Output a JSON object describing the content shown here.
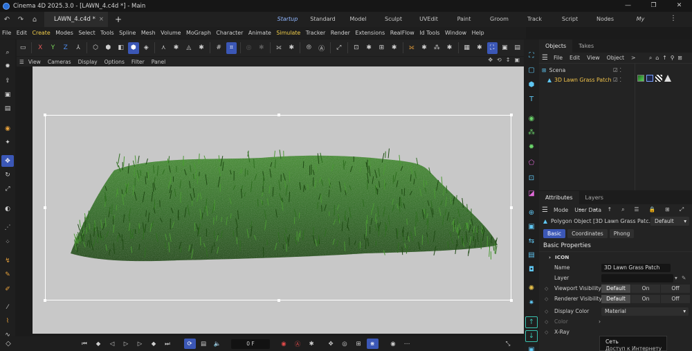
{
  "window": {
    "title": "Cinema 4D 2025.3.0 - [LAWN_4.c4d *] - Main",
    "controls": [
      "—",
      "❐",
      "✕"
    ]
  },
  "tabs": {
    "document": "LAWN_4.c4d *",
    "close": "×",
    "add": "+",
    "layouts": [
      "Startup",
      "Standard",
      "Model",
      "Sculpt",
      "UVEdit",
      "Paint",
      "Groom",
      "Track",
      "Script",
      "Nodes",
      "My"
    ],
    "active_layout": "Startup"
  },
  "menu": [
    "File",
    "Edit",
    "Create",
    "Modes",
    "Select",
    "Tools",
    "Spline",
    "Mesh",
    "Volume",
    "MoGraph",
    "Character",
    "Animate",
    "Simulate",
    "Tracker",
    "Render",
    "Extensions",
    "RealFlow",
    "Id Tools",
    "Window",
    "Help"
  ],
  "menu_highlight": [
    "Create",
    "Simulate"
  ],
  "toolbar": {
    "axis_x": "X",
    "axis_y": "Y",
    "axis_z": "Z"
  },
  "viewport": {
    "menu": [
      "View",
      "Cameras",
      "Display",
      "Options",
      "Filter",
      "Panel"
    ],
    "background": "#c8c8c8",
    "grass_colors": [
      "#1f4a14",
      "#2f6e20",
      "#4b9a34"
    ]
  },
  "timeline": {
    "frame": "0 F"
  },
  "objects_panel": {
    "tabs": [
      "Objects",
      "Takes"
    ],
    "menu": [
      "File",
      "Edit",
      "View",
      "Object"
    ],
    "more": ">",
    "items": [
      {
        "label": "Scena",
        "color": "#cfcfcf"
      },
      {
        "label": "3D Lawn Grass Patch",
        "color": "#f2c44b"
      }
    ]
  },
  "attributes_panel": {
    "tabs": [
      "Attributes",
      "Layers"
    ],
    "menu": [
      "Mode",
      "User Data"
    ],
    "object_title": "Polygon Object [3D Lawn Grass Patc...",
    "mode_dropdown": "Default",
    "subtabs": [
      "Basic",
      "Coordinates",
      "Phong"
    ],
    "active_subtab": "Basic",
    "section": "Basic Properties",
    "icon_group": "ICON",
    "props": {
      "name_label": "Name",
      "name_value": "3D Lawn Grass Patch",
      "layer_label": "Layer",
      "viewport_visibility_label": "Viewport Visibility",
      "renderer_visibility_label": "Renderer Visibility",
      "visibility_options": [
        "Default",
        "On",
        "Off"
      ],
      "display_color_label": "Display Color",
      "display_color_value": "Material",
      "color_label": "Color",
      "xray_label": "X-Ray"
    }
  },
  "tooltip": {
    "line1": "Сеть",
    "line2": "Доступ к Интернету"
  }
}
